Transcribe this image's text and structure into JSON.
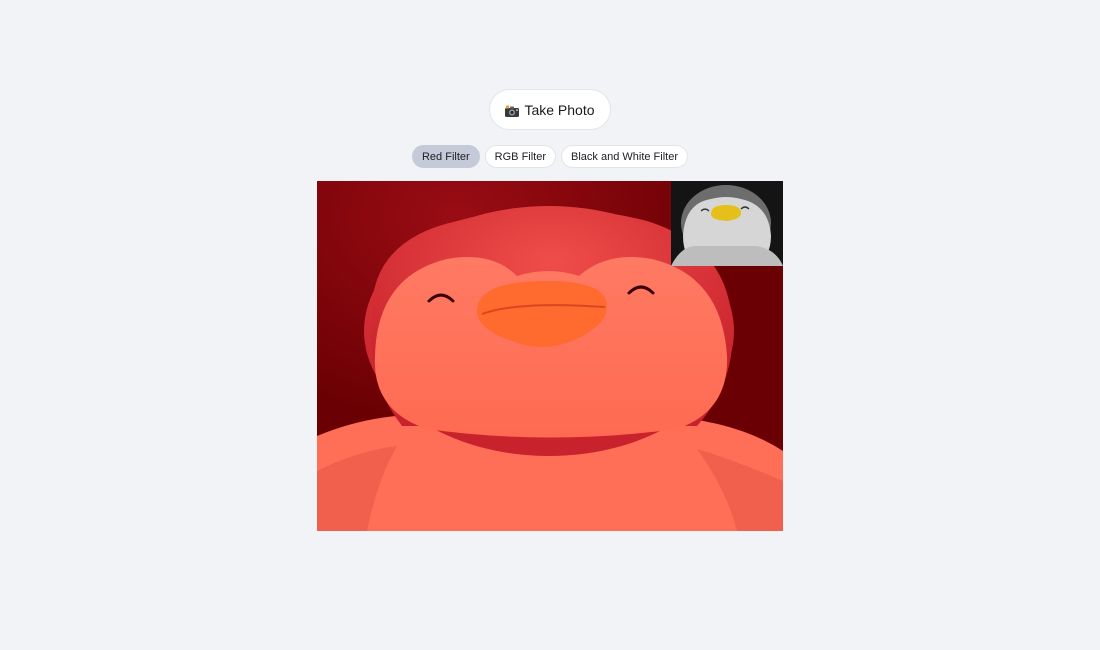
{
  "camera": {
    "take_photo_label": "Take Photo",
    "take_photo_icon": "camera-icon"
  },
  "filters": {
    "active": "Red Filter",
    "items": [
      {
        "label": "Red Filter"
      },
      {
        "label": "RGB Filter"
      },
      {
        "label": "Black and White Filter"
      }
    ]
  },
  "colors": {
    "page_background": "#f2f3f6",
    "active_filter_background": "#c4cad7",
    "red_filter_tint": "#ff6a4f",
    "red_background": "#6a0003"
  }
}
